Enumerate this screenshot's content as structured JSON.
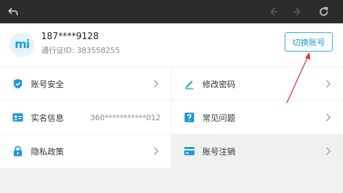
{
  "account": {
    "phone": "187****9128",
    "uid": "通行证ID: 383558255",
    "avatar_text": "mi",
    "switch_label": "切换账号"
  },
  "menu": {
    "left": [
      {
        "label": "账号安全",
        "icon": "shield-icon"
      },
      {
        "label": "实名信息",
        "icon": "id-card-icon",
        "value": "360***********012"
      },
      {
        "label": "隐私政策",
        "icon": "lock-icon"
      }
    ],
    "right": [
      {
        "label": "修改密码",
        "icon": "pencil-icon"
      },
      {
        "label": "常见问题",
        "icon": "question-icon"
      },
      {
        "label": "账号注销",
        "icon": "card-icon"
      }
    ]
  },
  "colors": {
    "accent": "#1f9ad6",
    "topbar": "#2b2b2b",
    "arrow": "#e53935"
  }
}
